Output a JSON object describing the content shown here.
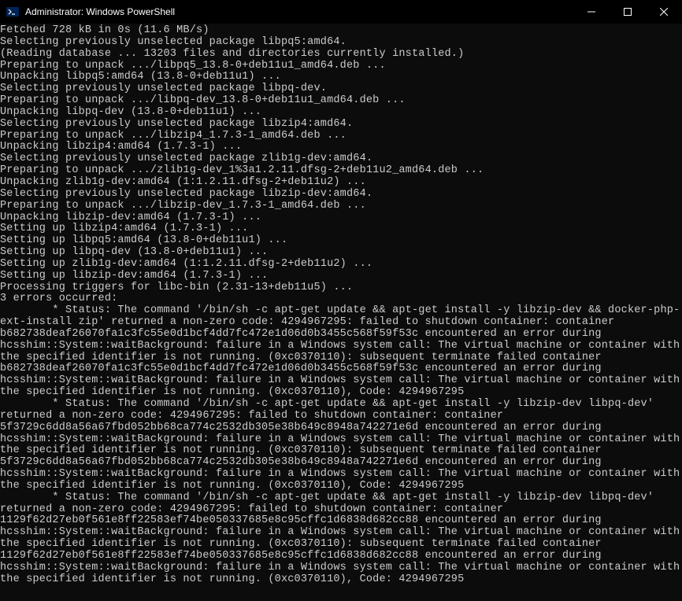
{
  "window": {
    "title": "Administrator: Windows PowerShell"
  },
  "terminal": {
    "lines": [
      "Fetched 728 kB in 0s (11.6 MB/s)",
      "Selecting previously unselected package libpq5:amd64.",
      "(Reading database ... 13203 files and directories currently installed.)",
      "Preparing to unpack .../libpq5_13.8-0+deb11u1_amd64.deb ...",
      "Unpacking libpq5:amd64 (13.8-0+deb11u1) ...",
      "Selecting previously unselected package libpq-dev.",
      "Preparing to unpack .../libpq-dev_13.8-0+deb11u1_amd64.deb ...",
      "Unpacking libpq-dev (13.8-0+deb11u1) ...",
      "Selecting previously unselected package libzip4:amd64.",
      "Preparing to unpack .../libzip4_1.7.3-1_amd64.deb ...",
      "Unpacking libzip4:amd64 (1.7.3-1) ...",
      "Selecting previously unselected package zlib1g-dev:amd64.",
      "Preparing to unpack .../zlib1g-dev_1%3a1.2.11.dfsg-2+deb11u2_amd64.deb ...",
      "Unpacking zlib1g-dev:amd64 (1:1.2.11.dfsg-2+deb11u2) ...",
      "Selecting previously unselected package libzip-dev:amd64.",
      "Preparing to unpack .../libzip-dev_1.7.3-1_amd64.deb ...",
      "Unpacking libzip-dev:amd64 (1.7.3-1) ...",
      "Setting up libzip4:amd64 (1.7.3-1) ...",
      "Setting up libpq5:amd64 (13.8-0+deb11u1) ...",
      "Setting up libpq-dev (13.8-0+deb11u1) ...",
      "Setting up zlib1g-dev:amd64 (1:1.2.11.dfsg-2+deb11u2) ...",
      "Setting up libzip-dev:amd64 (1.7.3-1) ...",
      "Processing triggers for libc-bin (2.31-13+deb11u5) ...",
      "3 errors occurred:",
      "        * Status: The command '/bin/sh -c apt-get update && apt-get install -y libzip-dev && docker-php-ext-install zip' returned a non-zero code: 4294967295: failed to shutdown container: container b682738deaf26070fa1c3fc55e0d1bcf4dd7fc472e1d06d0b3455c568f59f53c encountered an error during hcsshim::System::waitBackground: failure in a Windows system call: The virtual machine or container with the specified identifier is not running. (0xc0370110): subsequent terminate failed container b682738deaf26070fa1c3fc55e0d1bcf4dd7fc472e1d06d0b3455c568f59f53c encountered an error during hcsshim::System::waitBackground: failure in a Windows system call: The virtual machine or container with the specified identifier is not running. (0xc0370110), Code: 4294967295",
      "        * Status: The command '/bin/sh -c apt-get update && apt-get install -y libzip-dev libpq-dev' returned a non-zero code: 4294967295: failed to shutdown container: container 5f3729c6dd8a56a67fbd052bb68ca774c2532db305e38b649c8948a742271e6d encountered an error during hcsshim::System::waitBackground: failure in a Windows system call: The virtual machine or container with the specified identifier is not running. (0xc0370110): subsequent terminate failed container 5f3729c6dd8a56a67fbd052bb68ca774c2532db305e38b649c8948a742271e6d encountered an error during hcsshim::System::waitBackground: failure in a Windows system call: The virtual machine or container with the specified identifier is not running. (0xc0370110), Code: 4294967295",
      "        * Status: The command '/bin/sh -c apt-get update && apt-get install -y libzip-dev libpq-dev' returned a non-zero code: 4294967295: failed to shutdown container: container 1129f62d27eb0f561e8ff22583ef74be050337685e8c95cffc1d6838d682cc88 encountered an error during hcsshim::System::waitBackground: failure in a Windows system call: The virtual machine or container with the specified identifier is not running. (0xc0370110): subsequent terminate failed container 1129f62d27eb0f561e8ff22583ef74be050337685e8c95cffc1d6838d682cc88 encountered an error during hcsshim::System::waitBackground: failure in a Windows system call: The virtual machine or container with the specified identifier is not running. (0xc0370110), Code: 4294967295"
    ]
  }
}
